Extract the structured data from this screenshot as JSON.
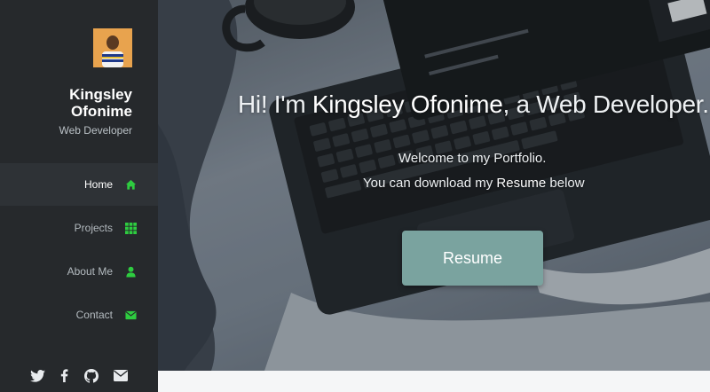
{
  "profile": {
    "name": "Kingsley Ofonime",
    "role": "Web Developer"
  },
  "nav": {
    "items": [
      {
        "label": "Home",
        "icon": "home-icon",
        "active": true
      },
      {
        "label": "Projects",
        "icon": "grid-icon",
        "active": false
      },
      {
        "label": "About Me",
        "icon": "user-icon",
        "active": false
      },
      {
        "label": "Contact",
        "icon": "envelope-icon",
        "active": false
      }
    ]
  },
  "social": [
    "twitter-icon",
    "facebook-icon",
    "github-icon",
    "envelope-icon"
  ],
  "hero": {
    "headline_pre": "Hi! I'm ",
    "headline_name": "Kingsley Ofonime",
    "headline_post": ", a Web Developer.",
    "welcome": "Welcome to my Portfolio.",
    "download_pre": "You can download my ",
    "download_highlight": "Resume",
    "download_post": " below",
    "button_label": "Resume"
  },
  "colors": {
    "accent_green": "#2ecc40",
    "sidebar": "#26292c",
    "button": "#7aa39f"
  }
}
